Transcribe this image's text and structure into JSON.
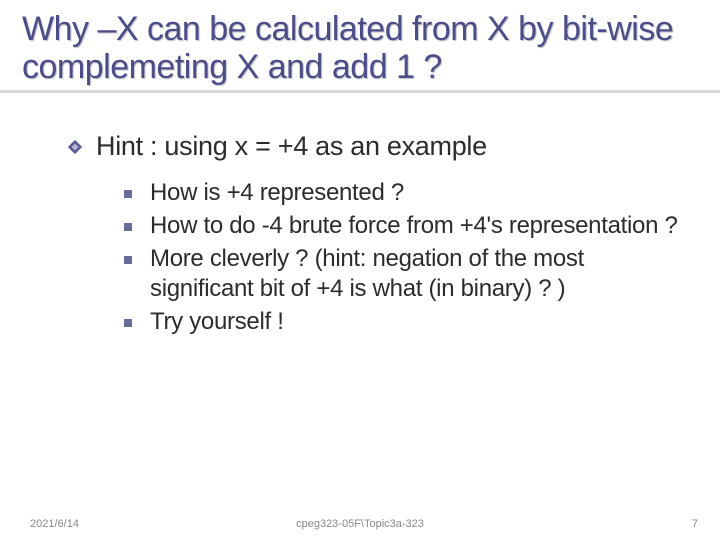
{
  "title": "Why –X can be calculated from X by bit-wise complemeting X and add 1 ?",
  "hint": "Hint : using x = +4 as an example",
  "items": [
    "How  is +4 represented ?",
    "How to do -4 brute force from +4's representation ?",
    "More cleverly ? (hint: negation of the most significant bit of +4  is what (in binary) ? )",
    "Try yourself !"
  ],
  "footer": {
    "date": "2021/6/14",
    "path": "cpeg323-05F\\Topic3a-323",
    "page": "7"
  }
}
